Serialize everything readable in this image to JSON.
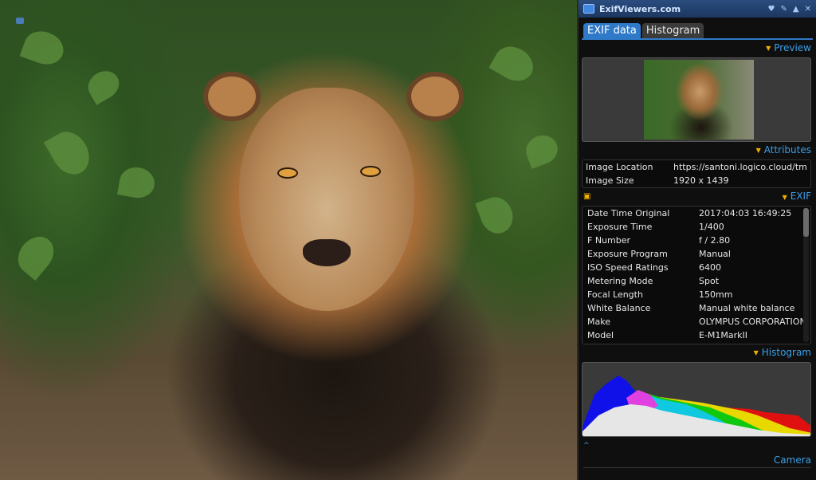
{
  "window": {
    "title": "ExifViewers.com",
    "icons": [
      "heart-icon",
      "wrench-icon",
      "warning-icon",
      "close-icon"
    ]
  },
  "tabs": [
    {
      "label": "EXIF data",
      "active": true
    },
    {
      "label": "Histogram",
      "active": false
    }
  ],
  "sections": {
    "preview": "Preview",
    "attributes": "Attributes",
    "exif": "EXIF",
    "histogram": "Histogram",
    "camera": "Camera"
  },
  "attributes": [
    {
      "key": "Image Location",
      "value": "https://santoni.logico.cloud/tmp..."
    },
    {
      "key": "Image Size",
      "value": "1920 x 1439"
    }
  ],
  "exif": [
    {
      "key": "Date Time Original",
      "value": "2017:04:03 16:49:25"
    },
    {
      "key": "Exposure Time",
      "value": "1/400"
    },
    {
      "key": "F Number",
      "value": "f / 2.80"
    },
    {
      "key": "Exposure Program",
      "value": "Manual"
    },
    {
      "key": "ISO Speed Ratings",
      "value": "6400"
    },
    {
      "key": "Metering Mode",
      "value": "Spot"
    },
    {
      "key": "Focal Length",
      "value": "150mm"
    },
    {
      "key": "White Balance",
      "value": "Manual white balance"
    },
    {
      "key": "Make",
      "value": "OLYMPUS CORPORATION"
    },
    {
      "key": "Model",
      "value": "E-M1MarkII"
    }
  ],
  "colors": {
    "accent": "#2f79c9",
    "section_text": "#3aa0e8",
    "arrow": "#f0b000",
    "titlebar": "#2a4c7e"
  }
}
